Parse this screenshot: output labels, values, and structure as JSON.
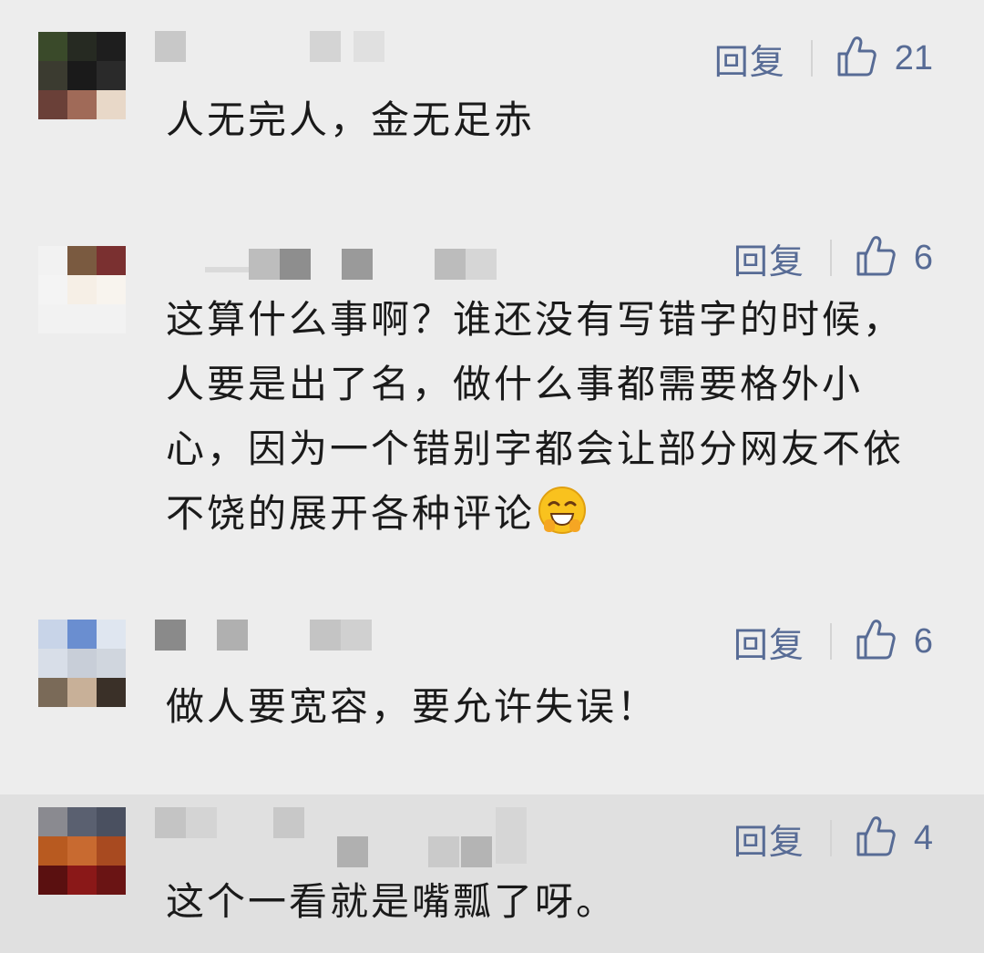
{
  "comments": [
    {
      "reply_label": "回复",
      "like_count": "21",
      "text": "人无完人，金无足赤",
      "avatar_colors": [
        "#3a4a2a",
        "#262a22",
        "#1e1e1e",
        "#3b3b30",
        "#1a1a1a",
        "#2a2a2a",
        "#6a4038",
        "#a06a58",
        "#e8d8c8"
      ]
    },
    {
      "reply_label": "回复",
      "like_count": "6",
      "text": "这算什么事啊？谁还没有写错字的时候，人要是出了名，做什么事都需要格外小心，因为一个错别字都会让部分网友不依不饶的展开各种评论",
      "emoji": "grinning-face-emoji",
      "avatar_colors": [
        "#f2f2f2",
        "#7a5a40",
        "#7a3030",
        "#f4f4f4",
        "#f6efe6",
        "#f8f4ee",
        "#f2f2f2",
        "#f2f2f2",
        "#f2f2f2"
      ]
    },
    {
      "reply_label": "回复",
      "like_count": "6",
      "text": "做人要宽容，要允许失误！",
      "avatar_colors": [
        "#c8d4e8",
        "#6a8ed0",
        "#dfe6f0",
        "#d8dee8",
        "#c8ced8",
        "#d0d6de",
        "#7a6a58",
        "#c8b098",
        "#3a3028"
      ]
    },
    {
      "reply_label": "回复",
      "like_count": "4",
      "text": "这个一看就是嘴瓢了呀。",
      "avatar_colors": [
        "#8a8a90",
        "#5a6070",
        "#4a5060",
        "#b85a20",
        "#c86a30",
        "#a84a20",
        "#5a1010",
        "#8a1818",
        "#6a1414"
      ]
    }
  ],
  "colors": {
    "background": "#ededed",
    "highlight_row": "#e0e0e0",
    "link_blue": "#576b95",
    "text": "#1a1a1a"
  }
}
